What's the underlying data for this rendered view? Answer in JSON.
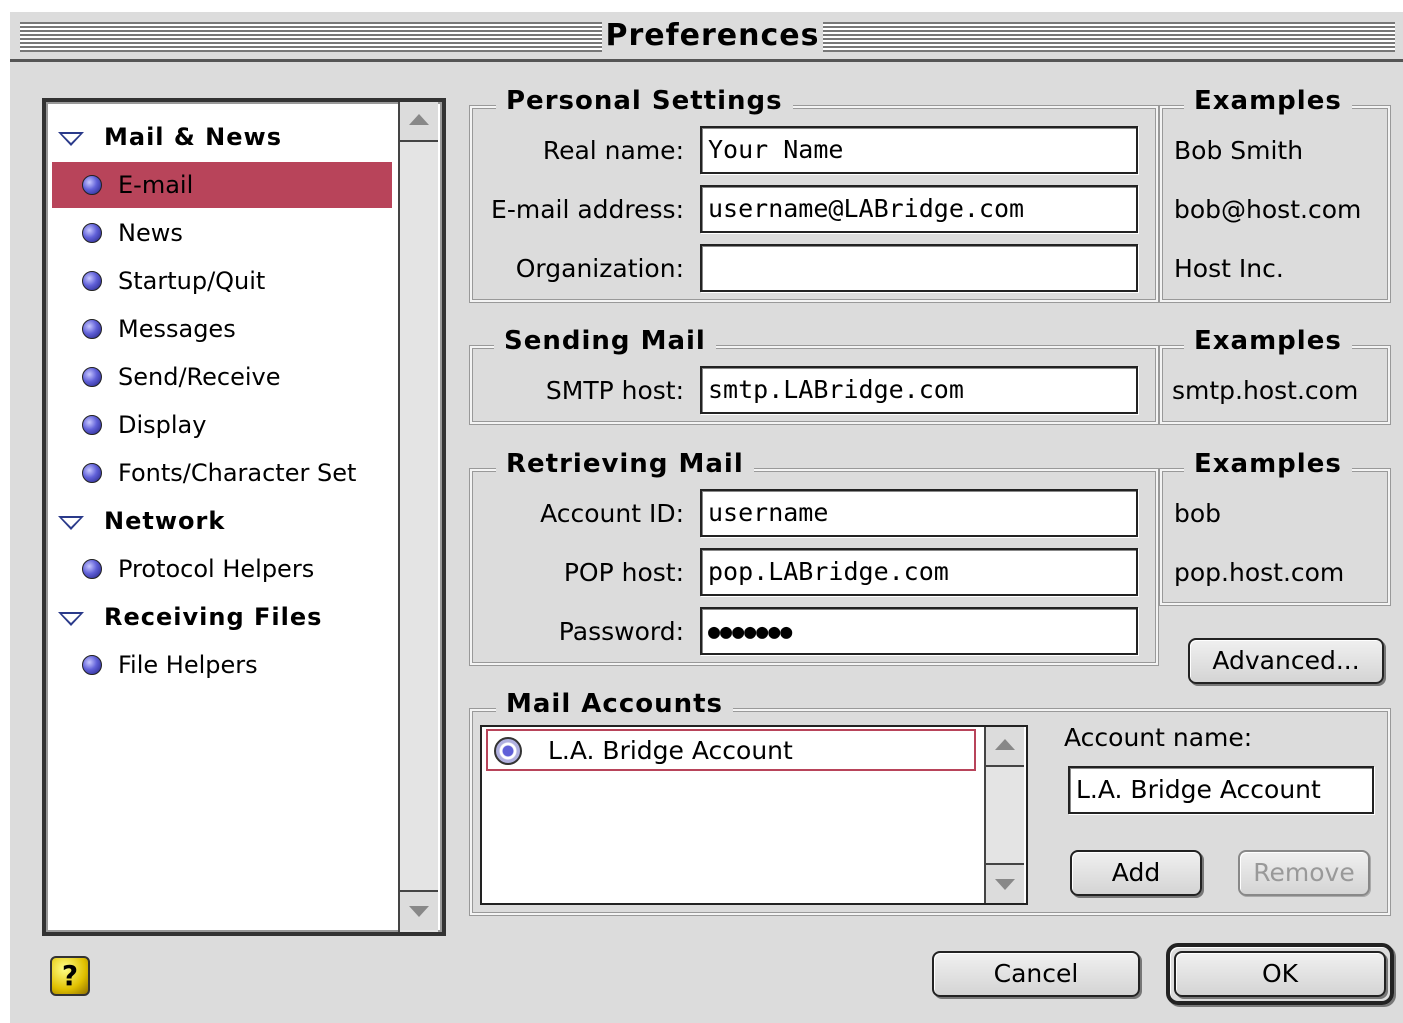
{
  "window": {
    "title": "Preferences"
  },
  "categories": {
    "groups": [
      {
        "label": "Mail & News"
      },
      {
        "label": "Network"
      },
      {
        "label": "Receiving Files"
      }
    ],
    "items": [
      {
        "label": "E-mail"
      },
      {
        "label": "News"
      },
      {
        "label": "Startup/Quit"
      },
      {
        "label": "Messages"
      },
      {
        "label": "Send/Receive"
      },
      {
        "label": "Display"
      },
      {
        "label": "Fonts/Character Set"
      },
      {
        "label": "Protocol Helpers"
      },
      {
        "label": "File Helpers"
      }
    ],
    "selected": "E-mail"
  },
  "personal": {
    "title": "Personal Settings",
    "examples_title": "Examples",
    "real_name_label": "Real name:",
    "real_name_value": "Your Name",
    "real_name_example": "Bob Smith",
    "email_label": "E-mail address:",
    "email_value": "username@LABridge.com",
    "email_example": "bob@host.com",
    "org_label": "Organization:",
    "org_value": "",
    "org_example": "Host Inc."
  },
  "sending": {
    "title": "Sending Mail",
    "examples_title": "Examples",
    "smtp_label": "SMTP host:",
    "smtp_value": "smtp.LABridge.com",
    "smtp_example": "smtp.host.com"
  },
  "retrieving": {
    "title": "Retrieving Mail",
    "examples_title": "Examples",
    "account_label": "Account ID:",
    "account_value": "username",
    "account_example": "bob",
    "pop_label": "POP host:",
    "pop_value": "pop.LABridge.com",
    "pop_example": "pop.host.com",
    "password_label": "Password:",
    "password_value": "●●●●●●●",
    "advanced_label": "Advanced..."
  },
  "accounts": {
    "title": "Mail Accounts",
    "list": [
      {
        "label": "L.A. Bridge Account"
      }
    ],
    "name_label": "Account name:",
    "name_value": "L.A. Bridge Account",
    "add_label": "Add",
    "remove_label": "Remove"
  },
  "footer": {
    "help_glyph": "?",
    "cancel_label": "Cancel",
    "ok_label": "OK"
  },
  "colors": {
    "selection": "#b8445a",
    "window_bg": "#dcdcdc"
  }
}
